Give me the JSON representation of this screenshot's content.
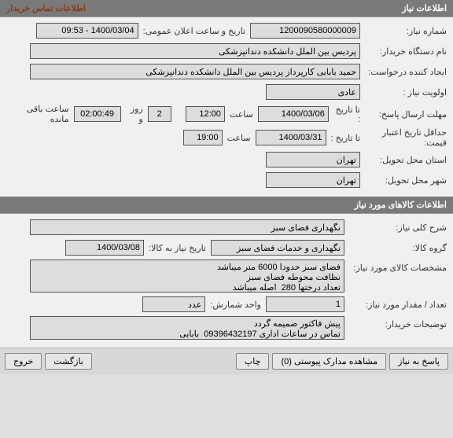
{
  "info_section": {
    "title": "اطلاعات نیاز",
    "contact_link": "اطلاعات تماس خریدار",
    "need_number_label": "شماره نیاز:",
    "need_number": "1200090580000009",
    "announce_label": "تاریخ و ساعت اعلان عمومی:",
    "announce_value": "1400/03/04 - 09:53",
    "buyer_label": "نام دستگاه خریدار:",
    "buyer_value": "پردیس بین الملل دانشکده دندانپزشکی",
    "requester_label": "ایجاد کننده درخواست:",
    "requester_value": "حمید بابایی کارپرداز پردیس بین الملل دانشکده دندانپزشکی",
    "priority_label": "اولویت نیاز :",
    "priority_value": "عادی",
    "deadline_label": "مهلت ارسال پاسخ:",
    "until_label": "تا تاریخ :",
    "deadline_date": "1400/03/06",
    "time_label": "ساعت",
    "deadline_time": "12:00",
    "days_value": "2",
    "days_label": "روز و",
    "remaining_time": "02:00:49",
    "remaining_label": "ساعت باقی مانده",
    "min_credit_label": "حداقل تاریخ اعتبار قیمت:",
    "min_credit_until": "تا تاریخ :",
    "min_credit_date": "1400/03/31",
    "min_credit_time": "19:00",
    "delivery_province_label": "استان محل تحویل:",
    "delivery_province": "تهران",
    "delivery_city_label": "شهر محل تحویل:",
    "delivery_city": "تهران"
  },
  "goods_section": {
    "title": "اطلاعات کالاهای مورد نیاز",
    "main_desc_label": "شرح کلی نیاز:",
    "main_desc_value": "نگهداری فضای سبز",
    "group_label": "گروه کالا:",
    "group_value": "نگهداری و خدمات فضای سبز",
    "need_date_label": "تاریخ نیاز به کالا:",
    "need_date_value": "1400/03/08",
    "spec_label": "مشخصات کالای مورد نیاز:",
    "spec_value": "فضای سبز حدودا 6000 متر میباشد\nنظافت محوطه فضای سبز\nتعداد درختها 280  اصله میباشد",
    "qty_label": "تعداد / مقدار مورد نیاز:",
    "qty_value": "1",
    "unit_label": "واحد شمارش:",
    "unit_value": "عدد",
    "notes_label": "توضیحات خریدار:",
    "notes_value": "پیش فاکتور ضمیمه گردد\nتماس در ساعات اداری 09396432197  بابایی"
  },
  "buttons": {
    "respond": "پاسخ به نیاز",
    "attachments": "مشاهده مدارک پیوستی (0)",
    "print": "چاپ",
    "back": "بازگشت",
    "exit": "خروج"
  }
}
